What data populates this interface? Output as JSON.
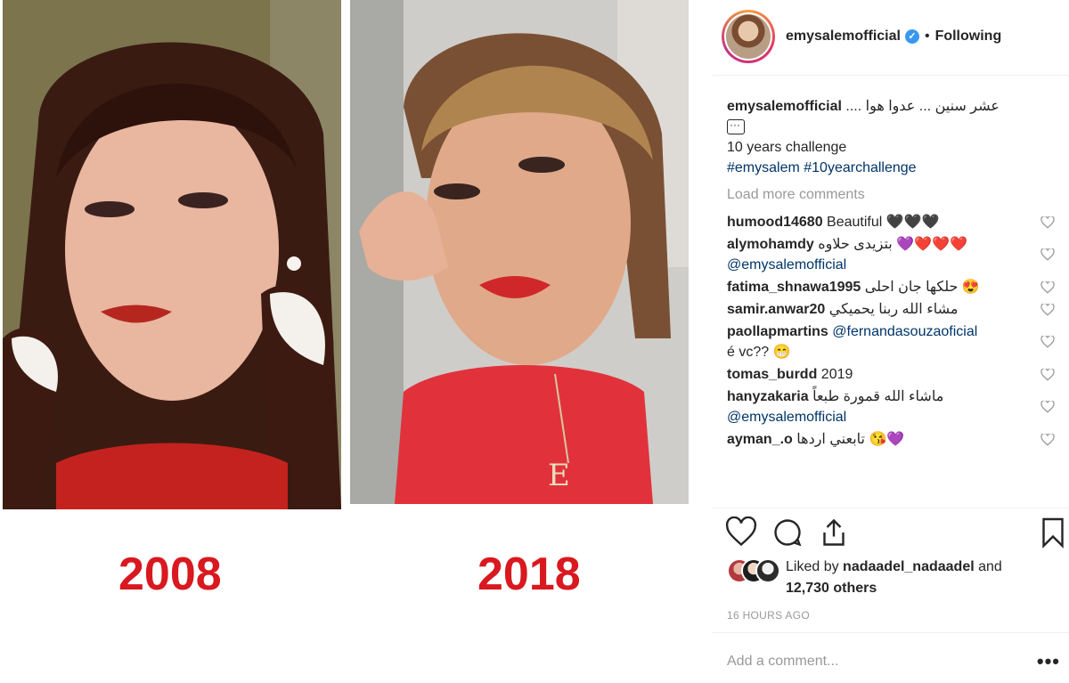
{
  "media": {
    "left_year": "2008",
    "right_year": "2018"
  },
  "header": {
    "username": "emysalemofficial",
    "verified_glyph": "✓",
    "separator": "•",
    "follow_status": "Following"
  },
  "caption": {
    "username": "emysalemofficial",
    "arabic_text": "عشر سنين ... عدوا هوا ....",
    "line2": "10 years challenge",
    "hashtags": "#emysalem #10yearchallenge"
  },
  "load_more": "Load more comments",
  "comments": [
    {
      "username": "humood14680",
      "text": "Beautiful",
      "emoji": "🖤🖤🖤"
    },
    {
      "username": "alymohamdy",
      "text": "بتزيدى حلاوه",
      "emoji": "💜❤️❤️❤️",
      "mention": "@emysalemofficial"
    },
    {
      "username": "fatima_shnawa1995",
      "text": "حلكها جان احلى",
      "emoji": "😍"
    },
    {
      "username": "samir.anwar20",
      "text": "مشاء الله ربنا يحميكي"
    },
    {
      "username": "paollapmartins",
      "mention": "@fernandasouzaoficial",
      "text": "é vc??",
      "emoji": "😁"
    },
    {
      "username": "tomas_burdd",
      "text": "2019"
    },
    {
      "username": "hanyzakaria",
      "text": "ماشاء الله قمورة طبعاً",
      "mention": "@emysalemofficial"
    },
    {
      "username": "ayman_.o",
      "text": "تابعني اردها",
      "emoji": "😘💜"
    }
  ],
  "likes": {
    "prefix": "Liked by",
    "liker": "nadaadel_nadaadel",
    "and": "and",
    "others": "12,730 others"
  },
  "timestamp": "16 HOURS AGO",
  "add_comment_placeholder": "Add a comment...",
  "more_glyph": "•••",
  "icons": [
    "heart-icon",
    "comment-icon",
    "share-icon",
    "bookmark-icon",
    "verified-icon",
    "more-options-icon"
  ],
  "colors": {
    "year_red": "#d9181f",
    "link": "#003569",
    "verified": "#3897f0",
    "muted": "#999999"
  }
}
